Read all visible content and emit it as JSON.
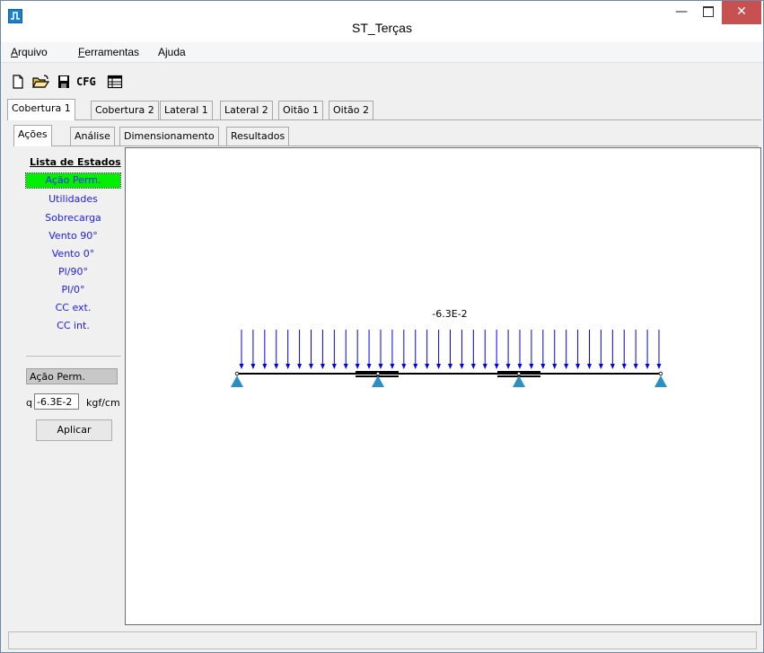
{
  "window": {
    "title": "ST_Terças"
  },
  "menu": {
    "items": [
      {
        "label": "Arquivo",
        "accel": "A",
        "rest": "rquivo"
      },
      {
        "label": "Ferramentas",
        "accel": "F",
        "rest": "erramentas"
      },
      {
        "label": "Ajuda",
        "accel": "",
        "rest": "Ajuda"
      }
    ]
  },
  "toolbar": {
    "cfg_label": "CFG",
    "icons": [
      "new-file-icon",
      "open-folder-icon",
      "save-icon",
      "cfg-icon",
      "table-icon"
    ]
  },
  "tabs_top": [
    "Cobertura 1",
    "Cobertura 2",
    "Lateral 1",
    "Lateral 2",
    "Oitão 1",
    "Oitão 2"
  ],
  "tabs_sub": [
    "Ações",
    "Análise",
    "Dimensionamento",
    "Resultados"
  ],
  "left": {
    "lista_title": "Lista de Estados",
    "states": [
      "Ação Perm.",
      "Utilidades",
      "Sobrecarga",
      "Vento 90°",
      "Vento 0°",
      "Pl/90°",
      "Pl/0°",
      "CC ext.",
      "CC int."
    ],
    "selected_state": "Ação Perm.",
    "q_label": "q",
    "q_value": "-6.3E-2",
    "q_unit": "kgf/cm",
    "apply_label": "Aplicar"
  },
  "diagram": {
    "load_label": "-6.3E-2",
    "load_color": "#0000ff",
    "support_color": "#2b8fc7"
  },
  "colors": {
    "selected_bg": "#00ee00",
    "state_text": "#1c1cff",
    "close_btn": "#c75050"
  }
}
